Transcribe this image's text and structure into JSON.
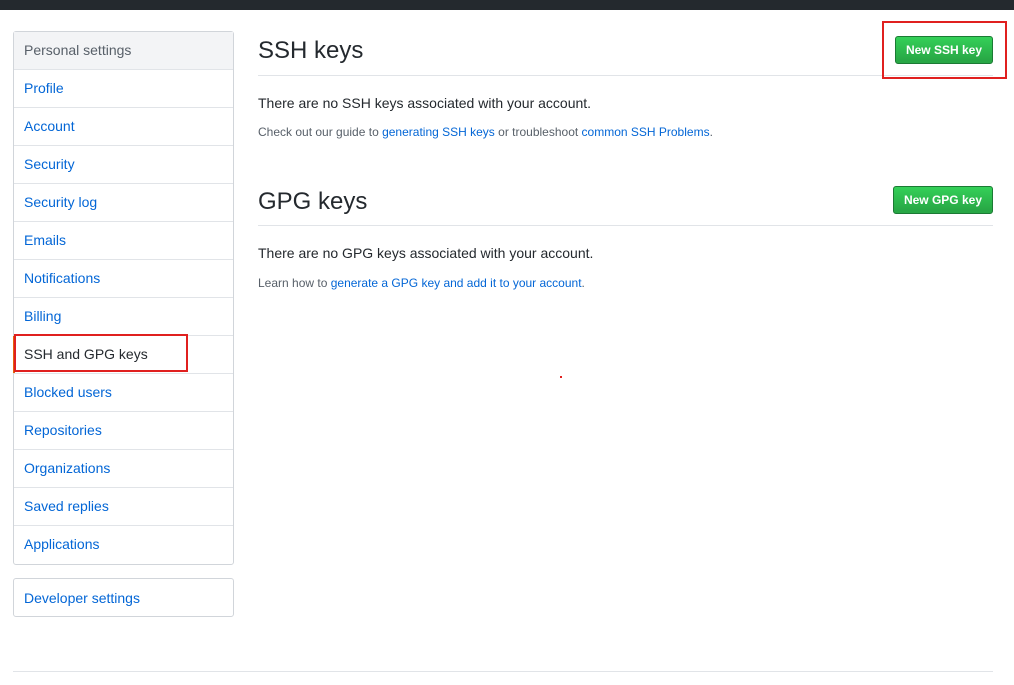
{
  "sidebar": {
    "heading": "Personal settings",
    "items": [
      {
        "label": "Profile"
      },
      {
        "label": "Account"
      },
      {
        "label": "Security"
      },
      {
        "label": "Security log"
      },
      {
        "label": "Emails"
      },
      {
        "label": "Notifications"
      },
      {
        "label": "Billing"
      },
      {
        "label": "SSH and GPG keys",
        "selected": true
      },
      {
        "label": "Blocked users"
      },
      {
        "label": "Repositories"
      },
      {
        "label": "Organizations"
      },
      {
        "label": "Saved replies"
      },
      {
        "label": "Applications"
      }
    ],
    "developer_settings": "Developer settings"
  },
  "ssh": {
    "title": "SSH keys",
    "new_button": "New SSH key",
    "blank": "There are no SSH keys associated with your account.",
    "note_prefix": "Check out our guide to ",
    "note_link1": "generating SSH keys",
    "note_middle": " or troubleshoot ",
    "note_link2": "common SSH Problems",
    "note_suffix": "."
  },
  "gpg": {
    "title": "GPG keys",
    "new_button": "New GPG key",
    "blank": "There are no GPG keys associated with your account.",
    "note_prefix": "Learn how to ",
    "note_link": "generate a GPG key and add it to your account",
    "note_suffix": "."
  },
  "colors": {
    "link": "#0366d6",
    "button_green": "#28a745",
    "annotation_red": "#e0201f",
    "topbar": "#24292e"
  }
}
